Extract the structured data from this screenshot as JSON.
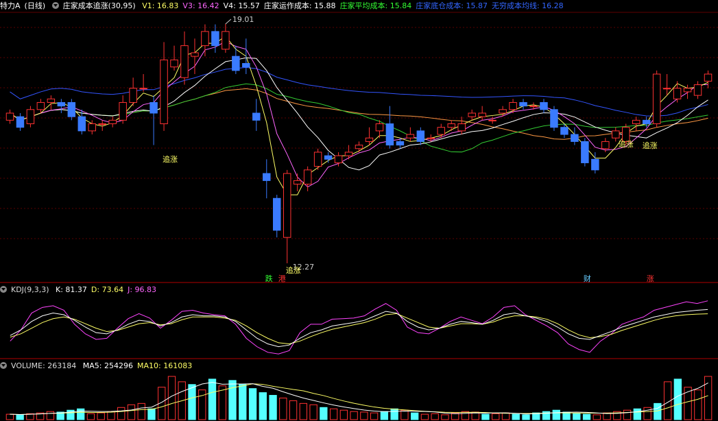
{
  "header": {
    "symbol": "特力A",
    "period": "(日线)",
    "indicator": "庄家成本追涨(30,95)",
    "items": [
      {
        "label": "V1: 16.83",
        "color": "#ffff66"
      },
      {
        "label": "V3: 16.42",
        "color": "#ff66ff"
      },
      {
        "label": "V4: 15.57",
        "color": "#ffffff"
      },
      {
        "label": "庄家运作成本: 15.88",
        "color": "#ffffff"
      },
      {
        "label": "庄家平均成本: 15.84",
        "color": "#33ff33"
      },
      {
        "label": "庄家底仓成本: 15.87",
        "color": "#3366ff"
      },
      {
        "label": "无穷成本均线: 16.28",
        "color": "#3366ff"
      }
    ]
  },
  "kdj_header": {
    "name": "KDJ(9,3,3)",
    "items": [
      {
        "label": "K: 81.37",
        "color": "#ffffff"
      },
      {
        "label": "D: 73.64",
        "color": "#ffff66"
      },
      {
        "label": "J: 96.83",
        "color": "#ff66ff"
      }
    ]
  },
  "vol_header": {
    "name": "VOLUME: 263184",
    "items": [
      {
        "label": "MA5: 254296",
        "color": "#ffffff"
      },
      {
        "label": "MA10: 161083",
        "color": "#ffff66"
      }
    ]
  },
  "annotations": {
    "high": "19.01",
    "low": "12.27",
    "signal_a": "追涨",
    "signal_b": "追涨",
    "signal_c": "追涨",
    "signal_d": "追涨",
    "marker_1": "跌",
    "marker_2": "港",
    "marker_3": "财",
    "marker_4": "涨"
  },
  "chart_data": {
    "type": "candlestick",
    "ylim": [
      12.0,
      19.3
    ],
    "candles": [
      [
        16.3,
        16.5,
        16.2,
        16.6
      ],
      [
        16.4,
        16.1,
        16.0,
        16.5
      ],
      [
        16.2,
        16.6,
        16.1,
        16.7
      ],
      [
        16.6,
        16.8,
        16.5,
        16.9
      ],
      [
        16.8,
        16.9,
        16.6,
        17.0
      ],
      [
        16.8,
        16.7,
        16.5,
        16.9
      ],
      [
        16.8,
        16.4,
        16.3,
        16.9
      ],
      [
        16.4,
        16.0,
        15.9,
        16.6
      ],
      [
        16.0,
        16.2,
        15.9,
        16.3
      ],
      [
        16.2,
        16.2,
        16.0,
        16.3
      ],
      [
        16.2,
        16.3,
        16.1,
        16.4
      ],
      [
        16.3,
        16.8,
        16.2,
        17.0
      ],
      [
        16.8,
        17.2,
        16.7,
        17.5
      ],
      [
        17.2,
        17.2,
        17.1,
        17.6
      ],
      [
        16.8,
        16.5,
        15.6,
        17.0
      ],
      [
        16.2,
        18.0,
        16.0,
        18.5
      ],
      [
        17.8,
        18.0,
        17.7,
        18.4
      ],
      [
        17.5,
        18.4,
        17.3,
        18.8
      ],
      [
        18.1,
        18.2,
        17.6,
        18.6
      ],
      [
        18.4,
        18.8,
        18.1,
        19.0
      ],
      [
        18.8,
        18.4,
        18.2,
        19.0
      ],
      [
        18.3,
        18.8,
        18.2,
        19.01
      ],
      [
        18.1,
        17.7,
        17.6,
        18.4
      ],
      [
        17.9,
        17.8,
        17.6,
        18.6
      ],
      [
        16.5,
        16.3,
        16.0,
        16.9
      ],
      [
        14.8,
        14.6,
        14.1,
        15.2
      ],
      [
        14.1,
        13.2,
        13.0,
        14.2
      ],
      [
        13.0,
        14.8,
        12.27,
        14.9
      ],
      [
        14.5,
        14.6,
        14.3,
        14.8
      ],
      [
        14.5,
        14.9,
        14.3,
        15.0
      ],
      [
        15.0,
        15.4,
        14.9,
        15.5
      ],
      [
        15.3,
        15.2,
        15.1,
        15.4
      ],
      [
        15.1,
        15.3,
        15.0,
        15.4
      ],
      [
        15.3,
        15.4,
        15.2,
        15.6
      ],
      [
        15.5,
        15.6,
        15.4,
        15.7
      ],
      [
        15.7,
        15.8,
        15.6,
        16.1
      ],
      [
        16.0,
        16.2,
        15.8,
        16.3
      ],
      [
        16.2,
        15.6,
        15.5,
        16.7
      ],
      [
        15.7,
        15.6,
        15.5,
        15.8
      ],
      [
        15.8,
        15.9,
        15.7,
        16.1
      ],
      [
        16.0,
        15.7,
        15.6,
        16.1
      ],
      [
        15.8,
        15.8,
        15.7,
        15.9
      ],
      [
        15.9,
        16.1,
        15.8,
        16.2
      ],
      [
        16.1,
        16.2,
        16.0,
        16.3
      ],
      [
        16.0,
        16.2,
        15.9,
        16.4
      ],
      [
        16.4,
        16.5,
        16.3,
        16.6
      ],
      [
        16.4,
        16.5,
        16.3,
        16.7
      ],
      [
        16.3,
        16.3,
        16.2,
        16.4
      ],
      [
        16.5,
        16.6,
        16.4,
        16.7
      ],
      [
        16.6,
        16.8,
        16.5,
        16.9
      ],
      [
        16.8,
        16.7,
        16.6,
        16.9
      ],
      [
        16.7,
        16.7,
        16.6,
        16.8
      ],
      [
        16.8,
        16.6,
        16.5,
        16.9
      ],
      [
        16.6,
        16.1,
        16.0,
        16.7
      ],
      [
        16.1,
        15.9,
        15.8,
        16.2
      ],
      [
        15.9,
        15.7,
        15.6,
        16.1
      ],
      [
        15.7,
        15.1,
        15.0,
        15.8
      ],
      [
        15.2,
        14.9,
        14.8,
        15.4
      ],
      [
        15.5,
        15.7,
        15.4,
        15.8
      ],
      [
        15.8,
        16.0,
        15.7,
        16.1
      ],
      [
        15.7,
        16.1,
        15.6,
        16.2
      ],
      [
        16.2,
        16.3,
        16.0,
        16.4
      ],
      [
        16.3,
        16.2,
        16.1,
        16.4
      ],
      [
        16.2,
        17.6,
        16.1,
        17.7
      ],
      [
        17.2,
        17.2,
        17.0,
        17.6
      ],
      [
        16.9,
        17.2,
        16.8,
        17.4
      ],
      [
        17.1,
        17.2,
        16.9,
        17.3
      ],
      [
        17.0,
        17.3,
        16.9,
        17.4
      ],
      [
        17.4,
        17.6,
        17.2,
        17.7
      ]
    ],
    "kdj": {
      "K": [
        35,
        45,
        60,
        70,
        75,
        72,
        62,
        50,
        40,
        38,
        45,
        55,
        62,
        60,
        52,
        58,
        68,
        72,
        70,
        70,
        68,
        60,
        45,
        30,
        20,
        15,
        18,
        30,
        40,
        45,
        52,
        55,
        58,
        62,
        70,
        78,
        75,
        60,
        50,
        45,
        48,
        55,
        60,
        58,
        55,
        62,
        72,
        75,
        70,
        66,
        60,
        50,
        38,
        30,
        28,
        35,
        42,
        50,
        56,
        62,
        68,
        72,
        76,
        78,
        80,
        81.37
      ],
      "D": [
        32,
        38,
        48,
        58,
        65,
        68,
        64,
        56,
        48,
        42,
        44,
        50,
        56,
        58,
        54,
        56,
        63,
        68,
        68,
        68,
        66,
        62,
        52,
        40,
        30,
        22,
        20,
        25,
        33,
        40,
        46,
        50,
        54,
        58,
        64,
        72,
        74,
        66,
        58,
        50,
        48,
        52,
        56,
        56,
        55,
        59,
        66,
        70,
        70,
        68,
        64,
        56,
        45,
        36,
        31,
        33,
        37,
        44,
        50,
        56,
        62,
        67,
        70,
        72,
        73,
        73.64
      ],
      "J": [
        25,
        45,
        75,
        85,
        88,
        80,
        55,
        38,
        28,
        30,
        48,
        65,
        74,
        66,
        48,
        62,
        78,
        80,
        75,
        72,
        70,
        55,
        30,
        15,
        5,
        2,
        8,
        40,
        55,
        55,
        64,
        65,
        66,
        70,
        82,
        92,
        80,
        50,
        40,
        38,
        48,
        60,
        68,
        62,
        56,
        68,
        85,
        88,
        72,
        62,
        52,
        40,
        20,
        10,
        5,
        25,
        38,
        55,
        62,
        68,
        80,
        85,
        90,
        95,
        92,
        96.83
      ]
    },
    "volume": {
      "values": [
        20,
        18,
        22,
        25,
        30,
        28,
        35,
        40,
        22,
        25,
        30,
        45,
        55,
        60,
        40,
        120,
        160,
        140,
        130,
        110,
        150,
        125,
        145,
        130,
        115,
        100,
        90,
        80,
        70,
        60,
        55,
        45,
        40,
        35,
        30,
        28,
        25,
        30,
        40,
        35,
        25,
        20,
        22,
        18,
        25,
        30,
        28,
        20,
        22,
        25,
        20,
        18,
        25,
        30,
        35,
        28,
        22,
        20,
        18,
        25,
        30,
        35,
        40,
        45,
        60,
        140,
        150,
        120,
        110,
        160
      ],
      "up": [
        true,
        false,
        true,
        true,
        true,
        false,
        false,
        false,
        true,
        true,
        true,
        true,
        true,
        true,
        false,
        true,
        true,
        true,
        false,
        true,
        false,
        true,
        false,
        false,
        false,
        false,
        false,
        true,
        true,
        true,
        true,
        false,
        true,
        true,
        true,
        true,
        true,
        false,
        false,
        true,
        false,
        true,
        true,
        true,
        true,
        true,
        true,
        false,
        true,
        true,
        false,
        false,
        false,
        false,
        false,
        false,
        false,
        false,
        true,
        true,
        true,
        true,
        false,
        true,
        false,
        true,
        false,
        true,
        true,
        true
      ]
    }
  }
}
